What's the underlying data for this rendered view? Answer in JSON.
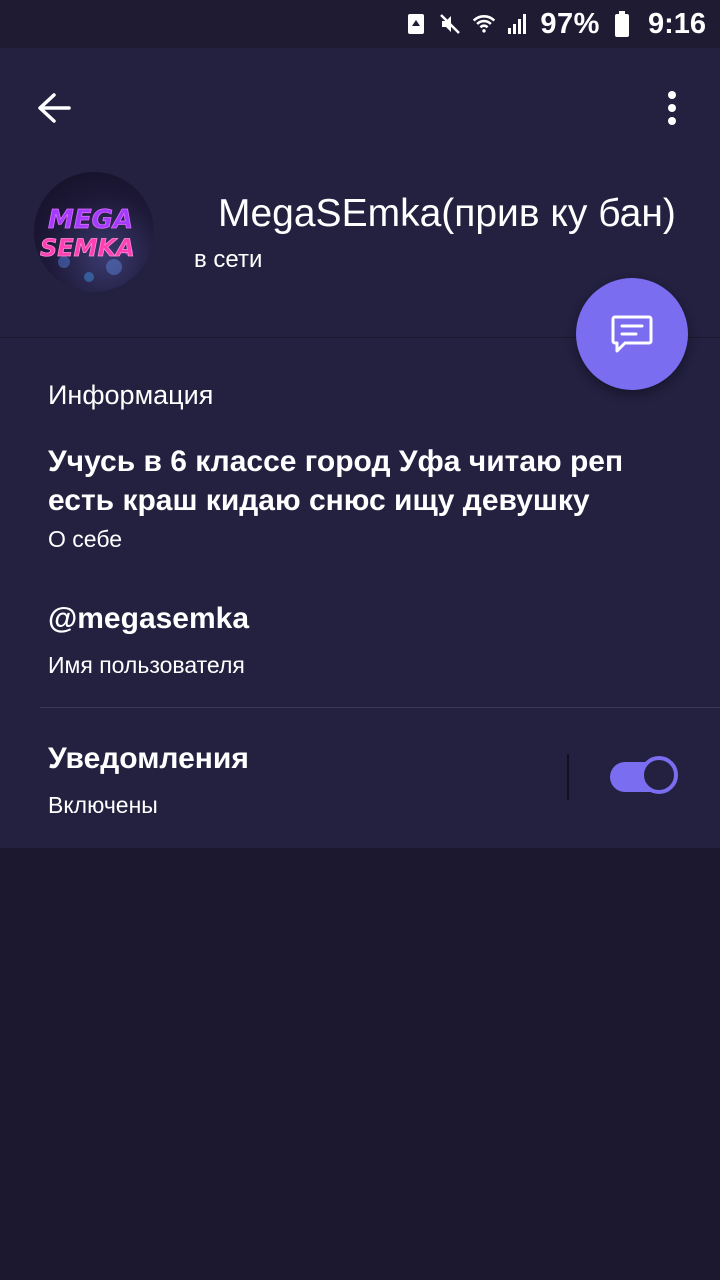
{
  "status_bar": {
    "battery": "97%",
    "time": "9:16",
    "icons": [
      "recycle-icon",
      "mute-icon",
      "wifi-icon",
      "signal-icon",
      "battery-icon"
    ]
  },
  "header": {
    "back_icon": "arrow-left-icon",
    "menu_icon": "more-vertical-icon",
    "avatar_text_top": "MEGA",
    "avatar_text_bottom": "SEMKA",
    "name": "MegaSEmka(прив ку бан)",
    "status": "в сети"
  },
  "fab": {
    "icon": "message-icon"
  },
  "info": {
    "section_title": "Информация",
    "bio": "Учусь в 6 классе город Уфа читаю реп есть краш кидаю снюс ищу девушку",
    "bio_caption": "О себе",
    "username": "@megasemka",
    "username_caption": "Имя пользователя",
    "notifications_title": "Уведомления",
    "notifications_caption": "Включены",
    "notifications_on": true
  },
  "colors": {
    "background": "#1b1830",
    "card": "#232040",
    "accent": "#7a6df0"
  }
}
